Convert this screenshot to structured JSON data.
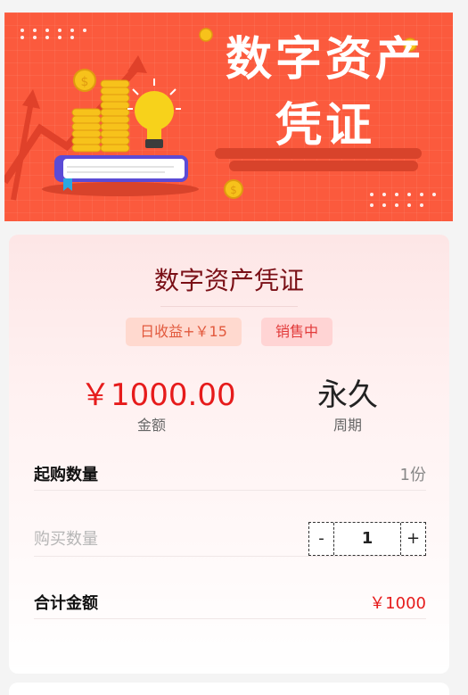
{
  "banner": {
    "title_line1": "数字资产",
    "title_line2": "凭证"
  },
  "product": {
    "title": "数字资产凭证",
    "income_tag": "日收益+￥15",
    "status_tag": "销售中",
    "amount_value": "￥1000.00",
    "amount_label": "金额",
    "period_value": "永久",
    "period_label": "周期"
  },
  "form": {
    "min_qty_label": "起购数量",
    "min_qty_value": "1份",
    "buy_qty_label": "购买数量",
    "stepper_minus": "-",
    "stepper_value": "1",
    "stepper_plus": "+",
    "total_label": "合计金额",
    "total_value": "￥1000"
  },
  "colors": {
    "banner_bg": "#fb5a3d",
    "accent_red": "#e61b1b",
    "title_dark_red": "#7a0f16"
  }
}
